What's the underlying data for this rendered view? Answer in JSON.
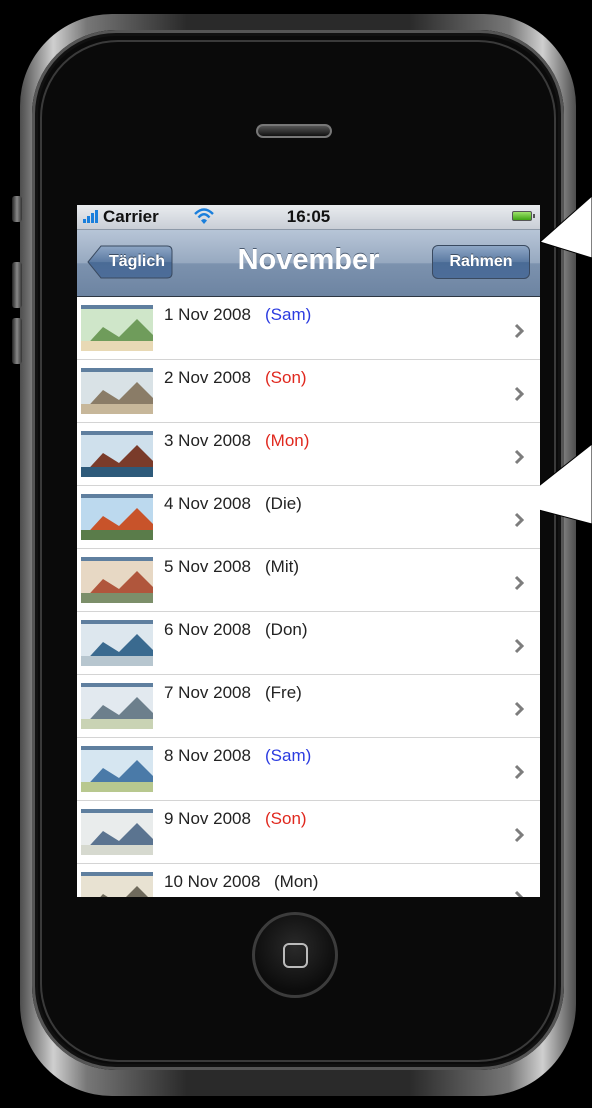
{
  "status_bar": {
    "carrier": "Carrier",
    "time": "16:05"
  },
  "nav_bar": {
    "back_label": "Täglich",
    "title": "November",
    "right_label": "Rahmen"
  },
  "list_items": [
    {
      "date": "1 Nov 2008",
      "day": "(Sam)",
      "day_color": "#2b3be0"
    },
    {
      "date": "2 Nov 2008",
      "day": "(Son)",
      "day_color": "#e0281e"
    },
    {
      "date": "3 Nov 2008",
      "day": "(Mon)",
      "day_color": "#e0281e"
    },
    {
      "date": "4 Nov 2008",
      "day": "(Die)",
      "day_color": "#222222"
    },
    {
      "date": "5 Nov 2008",
      "day": "(Mit)",
      "day_color": "#222222"
    },
    {
      "date": "6 Nov 2008",
      "day": "(Don)",
      "day_color": "#222222"
    },
    {
      "date": "7 Nov 2008",
      "day": "(Fre)",
      "day_color": "#222222"
    },
    {
      "date": "8 Nov 2008",
      "day": "(Sam)",
      "day_color": "#2b3be0"
    },
    {
      "date": "9 Nov 2008",
      "day": "(Son)",
      "day_color": "#e0281e"
    },
    {
      "date": "10 Nov 2008",
      "day": "(Mon)",
      "day_color": "#222222"
    }
  ],
  "icons": {
    "row_disclosure": "chevron-right-icon",
    "status_wifi": "wifi-icon",
    "status_battery": "battery-icon",
    "status_signal": "signal-bars-icon"
  }
}
